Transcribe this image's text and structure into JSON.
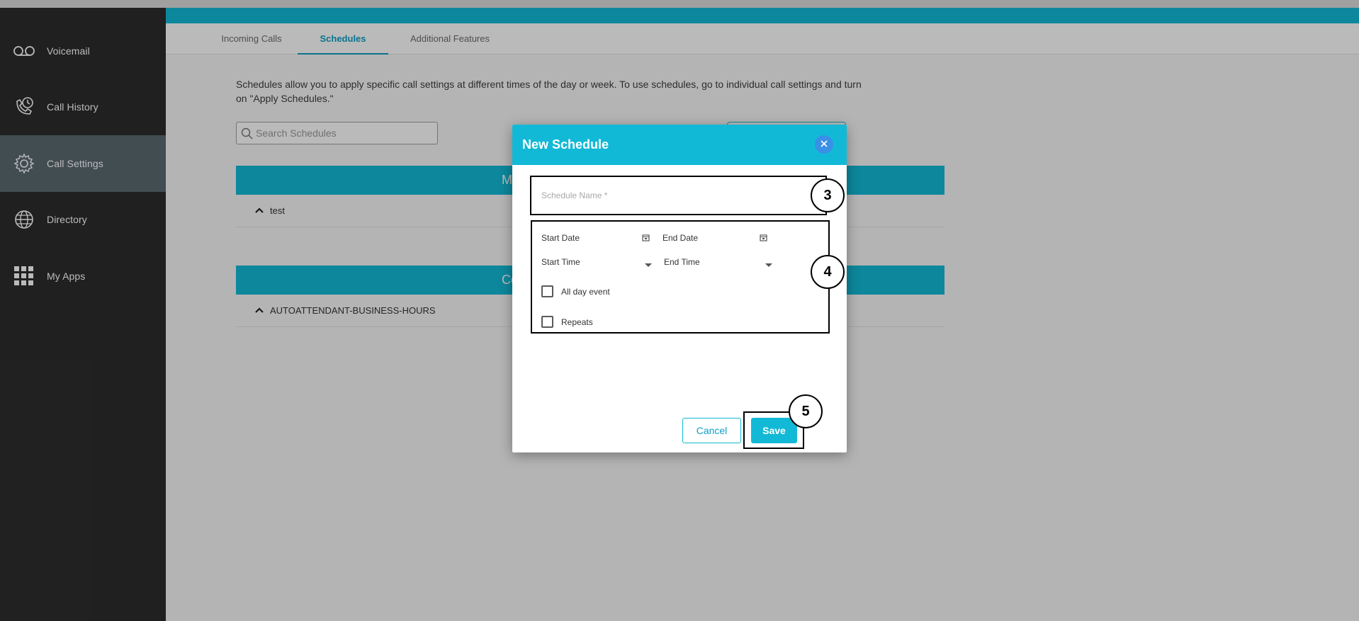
{
  "sidebar": {
    "items": [
      {
        "label": "Voicemail",
        "icon": "voicemail-icon"
      },
      {
        "label": "Call History",
        "icon": "phone-history-icon"
      },
      {
        "label": "Call Settings",
        "icon": "gear-icon",
        "active": true
      },
      {
        "label": "Directory",
        "icon": "globe-icon"
      },
      {
        "label": "My Apps",
        "icon": "apps-grid-icon"
      }
    ]
  },
  "tabs": [
    {
      "label": "Incoming Calls"
    },
    {
      "label": "Schedules",
      "active": true
    },
    {
      "label": "Additional Features"
    }
  ],
  "main": {
    "intro": "Schedules allow you to apply specific call settings at different times of the day or week. To use schedules, go to individual call settings and turn on \"Apply Schedules.\"",
    "search_placeholder": "Search Schedules",
    "sections": [
      {
        "header": "M",
        "rows": [
          "test"
        ]
      },
      {
        "header": "Corpo",
        "rows": [
          "AUTOATTENDANT-BUSINESS-HOURS"
        ]
      }
    ]
  },
  "modal": {
    "title": "New Schedule",
    "name_placeholder": "Schedule Name *",
    "start_date": "Start Date",
    "end_date": "End Date",
    "start_time": "Start Time",
    "end_time": "End Time",
    "all_day": "All day event",
    "repeats": "Repeats",
    "cancel": "Cancel",
    "save": "Save"
  },
  "annotations": [
    "3",
    "4",
    "5"
  ],
  "colors": {
    "accent": "#12b9d6",
    "sidebar": "#2d2d2d",
    "active_nav": "#5b6a71",
    "close_button": "#3a8fe6"
  }
}
